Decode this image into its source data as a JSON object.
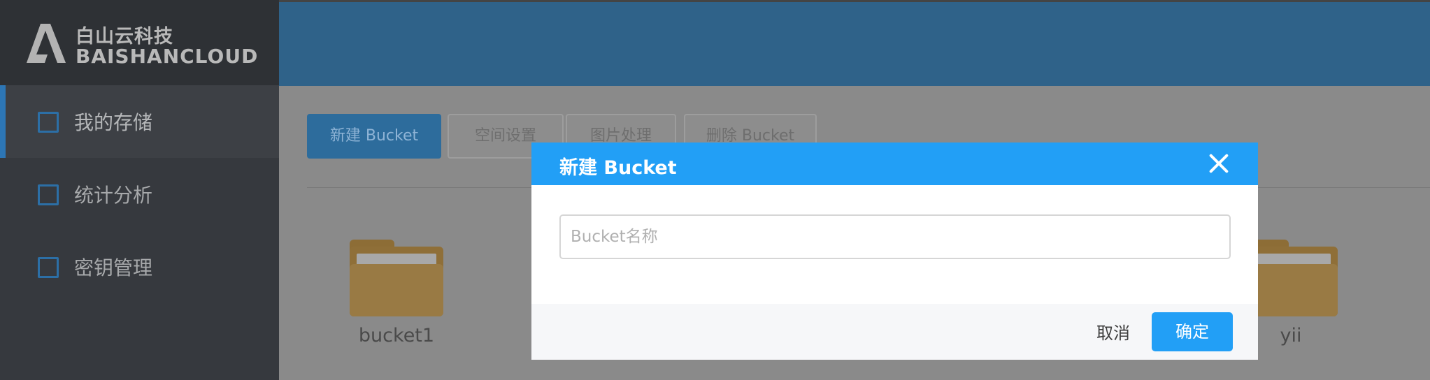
{
  "brand": {
    "name_cn": "白山云科技",
    "name_en": "BAISHANCLOUD"
  },
  "sidebar": {
    "items": [
      {
        "label": "我的存储",
        "icon": "storage-icon",
        "active": true
      },
      {
        "label": "统计分析",
        "icon": "bar-chart-icon",
        "active": false
      },
      {
        "label": "密钥管理",
        "icon": "key-icon",
        "active": false
      }
    ]
  },
  "toolbar": {
    "new_bucket": "新建 Bucket",
    "space_settings": "空间设置",
    "image_processing": "图片处理",
    "delete_bucket": "删除 Bucket"
  },
  "buckets": [
    {
      "name": "bucket1"
    },
    {
      "name": "yii"
    }
  ],
  "modal": {
    "title": "新建 Bucket",
    "input_placeholder": "Bucket名称",
    "input_value": "",
    "cancel_label": "取消",
    "confirm_label": "确定"
  },
  "colors": {
    "modal_header": "#229ff6",
    "confirm_button": "#229ff6",
    "topbar": "#2f6289",
    "sidebar": "#36393e"
  }
}
